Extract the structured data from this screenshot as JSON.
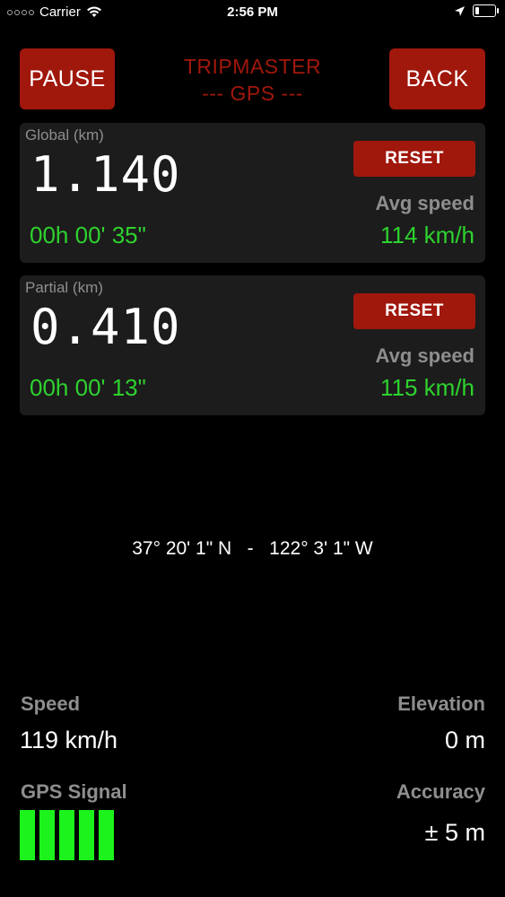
{
  "status_bar": {
    "carrier": "Carrier",
    "time": "2:56 PM",
    "battery_level": 0.2
  },
  "header": {
    "pause_label": "PAUSE",
    "back_label": "BACK",
    "title_line1": "TRIPMASTER",
    "title_line2": "--- GPS ---"
  },
  "global": {
    "label": "Global (km)",
    "distance": "1.140",
    "time": "00h 00' 35\"",
    "reset_label": "RESET",
    "avg_label": "Avg speed",
    "avg_value": "114 km/h"
  },
  "partial": {
    "label": "Partial (km)",
    "distance": "0.410",
    "time": "00h 00' 13\"",
    "reset_label": "RESET",
    "avg_label": "Avg speed",
    "avg_value": "115 km/h"
  },
  "coordinates": "37° 20' 1\" N   -   122° 3' 1\" W",
  "stats": {
    "speed_label": "Speed",
    "speed_value": "119 km/h",
    "elevation_label": "Elevation",
    "elevation_value": "0 m",
    "gps_signal_label": "GPS Signal",
    "gps_signal_bars": 5,
    "accuracy_label": "Accuracy",
    "accuracy_value": "± 5 m"
  },
  "colors": {
    "accent_red": "#a0170c",
    "green": "#2ed22e",
    "signal_green": "#1cf21c",
    "panel_bg": "#1c1c1c"
  }
}
